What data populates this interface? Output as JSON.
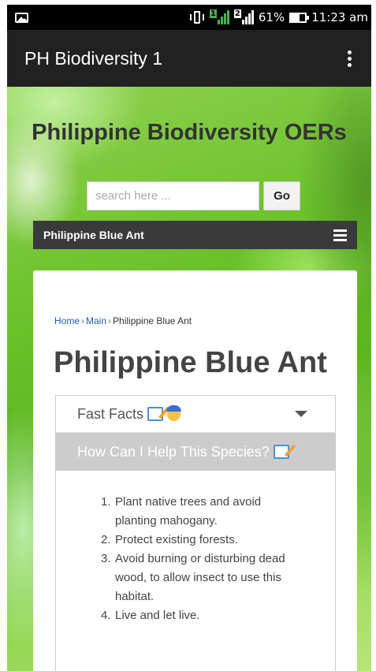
{
  "status_bar": {
    "battery_percent": "61%",
    "battery_level": 0.61,
    "time": "11:23 am",
    "sim1_label": "1",
    "sim2_label": "2",
    "icons": [
      "image-notification-icon",
      "vibrate-icon",
      "signal-icon",
      "battery-icon"
    ]
  },
  "app_bar": {
    "title": "PH Biodiversity 1",
    "menu_icon": "overflow-menu-icon"
  },
  "site": {
    "title": "Philippine Biodiversity OERs",
    "search": {
      "placeholder": "search here ...",
      "button_label": "Go"
    },
    "nav": {
      "label": "Philippine Blue Ant",
      "menu_icon": "hamburger-icon"
    }
  },
  "page": {
    "breadcrumb": [
      {
        "label": "Home",
        "link": true
      },
      {
        "label": "Main",
        "link": true
      },
      {
        "label": "Philippine Blue Ant",
        "link": false
      }
    ],
    "breadcrumb_separator": "›",
    "title": "Philippine Blue Ant",
    "accordion": {
      "header_label": "Fast Facts",
      "sub_label": "How Can I Help This Species?",
      "items": [
        "Plant native trees and avoid planting mahogany.",
        "Protect existing forests.",
        "Avoid burning or disturbing dead wood, to allow insect to use this habitat.",
        "Live and let live."
      ]
    }
  },
  "colors": {
    "app_bar": "#212121",
    "nav_bar": "#3a3a3a",
    "link": "#1a5fb4",
    "accordion_sub_bg": "#cccccc",
    "signal_green": "#4caf50"
  }
}
